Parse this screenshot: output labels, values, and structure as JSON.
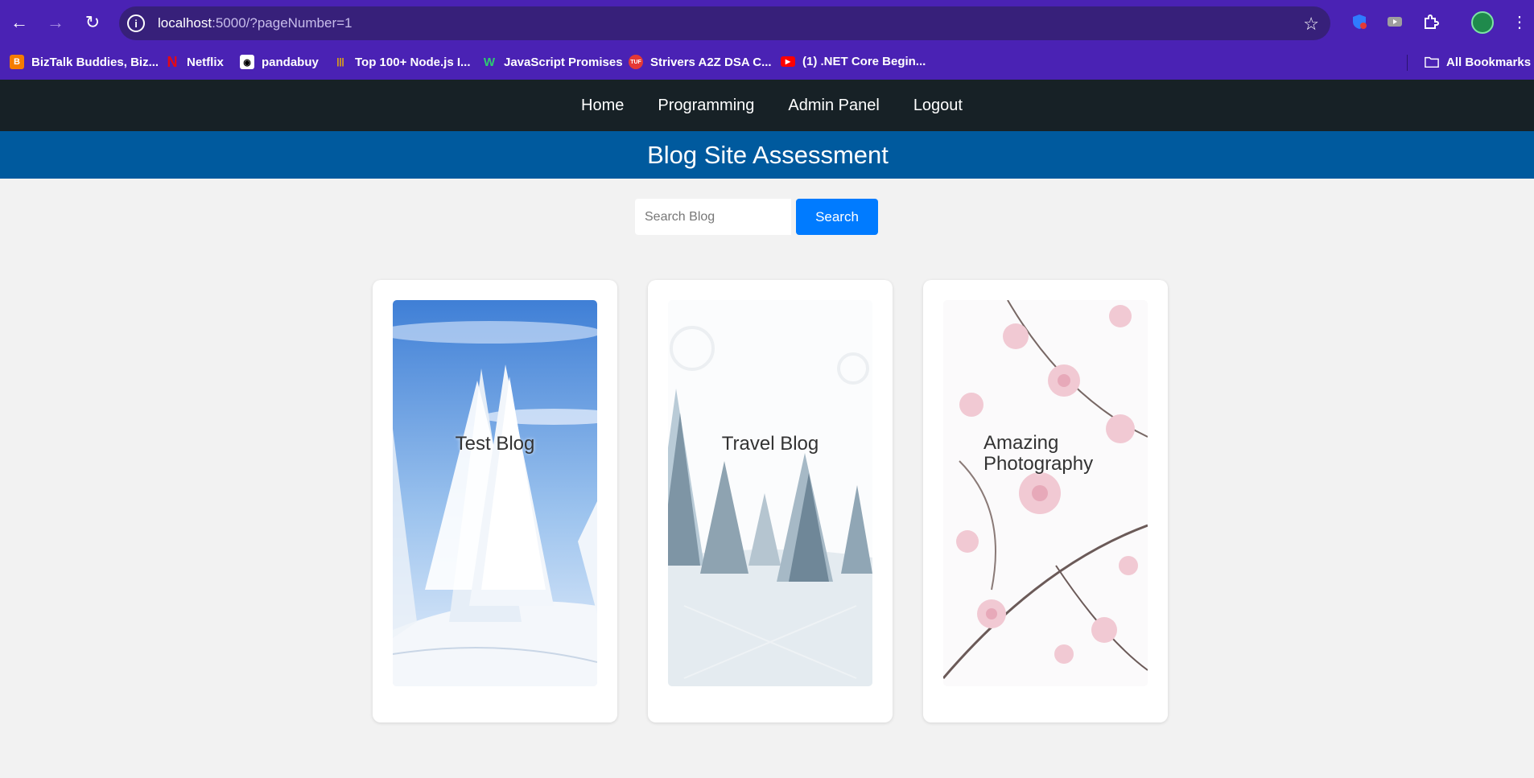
{
  "browser": {
    "url_host": "localhost",
    "url_rest": ":5000/?pageNumber=1",
    "bookmarks": [
      {
        "label": "BizTalk Buddies, Biz...",
        "icon": "blogger-icon",
        "color": "#f57c00"
      },
      {
        "label": "Netflix",
        "icon": "netflix-icon",
        "color": "#e50914"
      },
      {
        "label": "pandabuy",
        "icon": "pandabuy-icon",
        "color": "#ffffff"
      },
      {
        "label": "Top 100+ Node.js I...",
        "icon": "bars-icon",
        "color": "#f0b400"
      },
      {
        "label": "JavaScript Promises",
        "icon": "w-icon",
        "color": "#2ecc71"
      },
      {
        "label": "Strivers A2Z DSA C...",
        "icon": "tuf-icon",
        "color": "#e53935"
      },
      {
        "label": "(1) .NET Core Begin...",
        "icon": "youtube-icon",
        "color": "#ff0000"
      }
    ],
    "all_bookmarks": "All Bookmarks"
  },
  "nav": {
    "items": [
      "Home",
      "Programming",
      "Admin Panel",
      "Logout"
    ]
  },
  "banner": {
    "title": "Blog Site Assessment"
  },
  "search": {
    "placeholder": "Search Blog",
    "button": "Search"
  },
  "cards": [
    {
      "title": "Test Blog"
    },
    {
      "title": "Travel Blog"
    },
    {
      "title_line1": "Amazing",
      "title_line2": "Photography"
    }
  ]
}
